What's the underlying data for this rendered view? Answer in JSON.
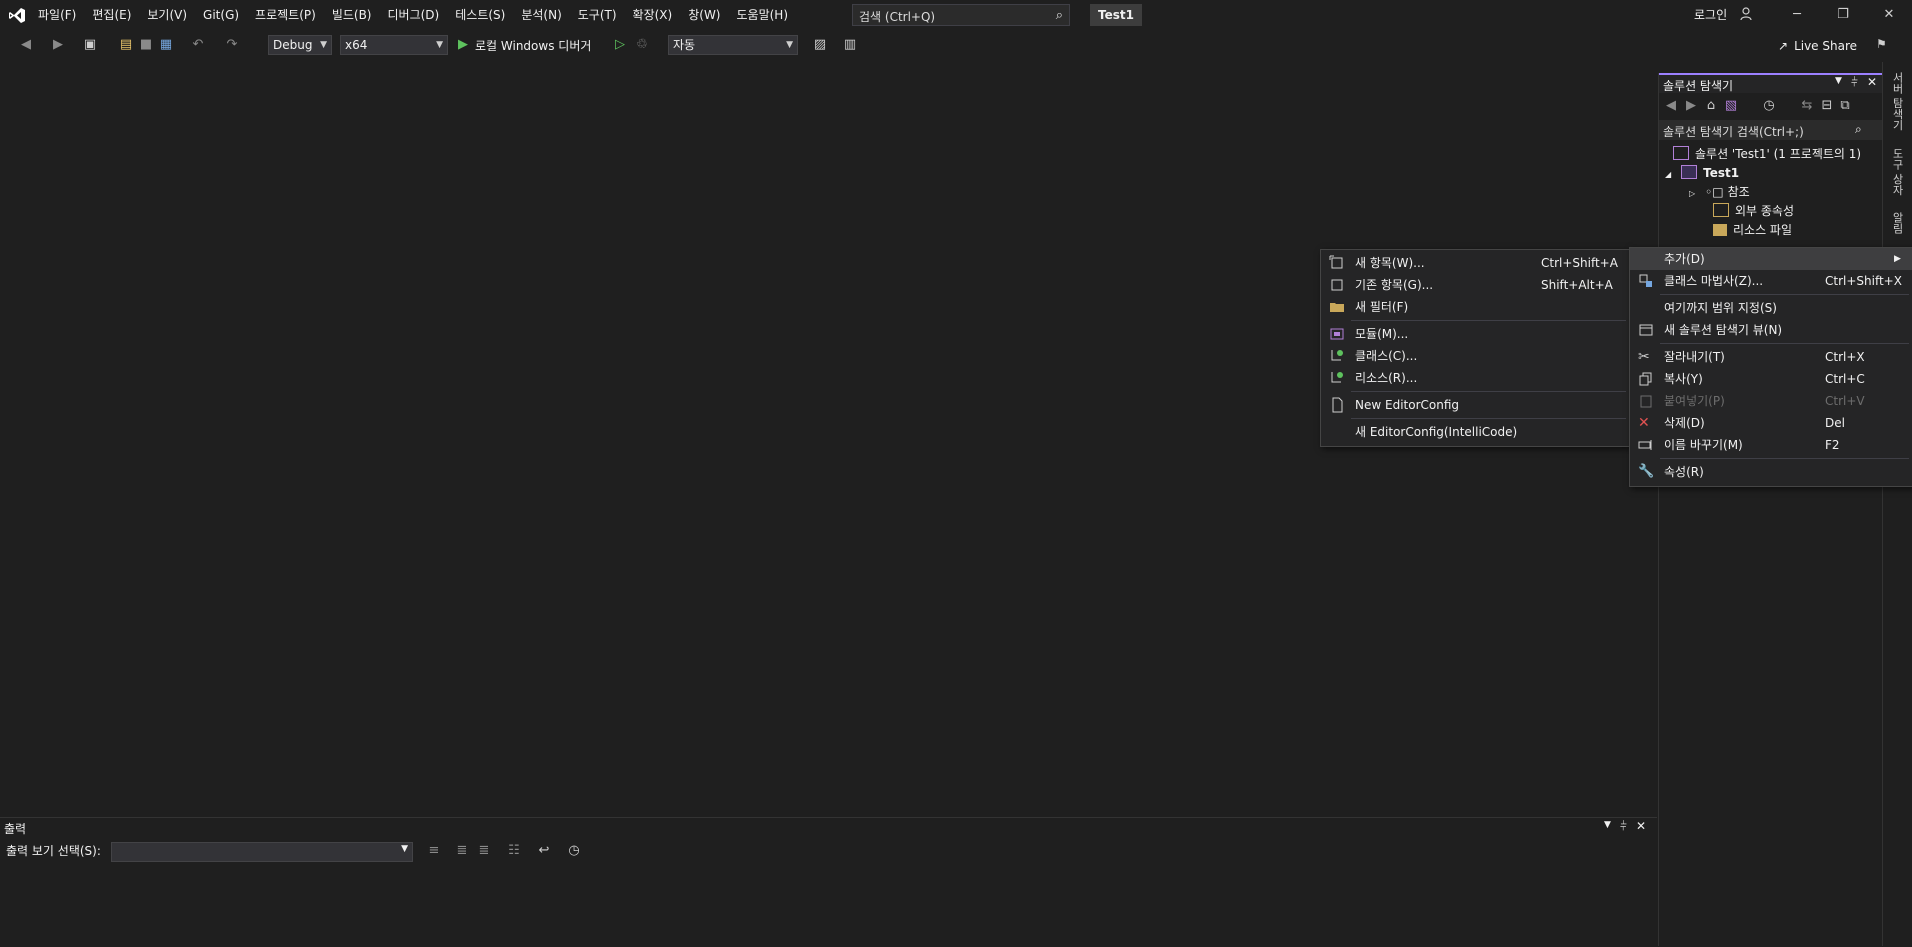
{
  "titlebar": {
    "menu": [
      "파일(F)",
      "편집(E)",
      "보기(V)",
      "Git(G)",
      "프로젝트(P)",
      "빌드(B)",
      "디버그(D)",
      "테스트(S)",
      "분석(N)",
      "도구(T)",
      "확장(X)",
      "창(W)",
      "도움말(H)"
    ],
    "search_placeholder": "검색 (Ctrl+Q)",
    "solution_name": "Test1",
    "login": "로그인",
    "window_buttons": [
      "minimize",
      "restore",
      "close"
    ]
  },
  "toolbar": {
    "config": "Debug",
    "platform": "x64",
    "run_label": "로컬 Windows 디버거",
    "target": "자동",
    "live_share": "Live Share"
  },
  "solution_explorer": {
    "title": "솔루션 탐색기",
    "search_placeholder": "솔루션 탐색기 검색(Ctrl+;)",
    "tree": [
      {
        "label": "솔루션 'Test1' (1 프로젝트의 1)",
        "bold": false
      },
      {
        "label": "Test1",
        "bold": true
      },
      {
        "label": "참조",
        "bold": false
      },
      {
        "label": "외부 종속성",
        "bold": false
      },
      {
        "label": "리소스 파일",
        "bold": false
      }
    ]
  },
  "side_tabs": [
    "서버 탐색기",
    "도구 상자",
    "알림"
  ],
  "output": {
    "title": "출력",
    "select_label": "출력 보기 선택(S):"
  },
  "context_menu": {
    "items": [
      {
        "label": "추가(D)",
        "shortcut": "",
        "highlighted": true,
        "submenu": true,
        "icon": "none"
      },
      {
        "label": "클래스 마법사(Z)...",
        "shortcut": "Ctrl+Shift+X",
        "icon": "class-wizard-icon"
      },
      {
        "label": "여기까지 범위 지정(S)",
        "shortcut": "",
        "icon": "none"
      },
      {
        "label": "새 솔루션 탐색기 뷰(N)",
        "shortcut": "",
        "icon": "new-view-icon"
      },
      {
        "label": "잘라내기(T)",
        "shortcut": "Ctrl+X",
        "icon": "cut-icon"
      },
      {
        "label": "복사(Y)",
        "shortcut": "Ctrl+C",
        "icon": "copy-icon"
      },
      {
        "label": "붙여넣기(P)",
        "shortcut": "Ctrl+V",
        "disabled": true,
        "icon": "paste-icon"
      },
      {
        "label": "삭제(D)",
        "shortcut": "Del",
        "icon": "delete-icon"
      },
      {
        "label": "이름 바꾸기(M)",
        "shortcut": "F2",
        "icon": "rename-icon"
      },
      {
        "label": "속성(R)",
        "shortcut": "",
        "icon": "wrench-icon"
      }
    ]
  },
  "submenu": {
    "items": [
      {
        "label": "새 항목(W)...",
        "shortcut": "Ctrl+Shift+A",
        "icon": "new-item-icon"
      },
      {
        "label": "기존 항목(G)...",
        "shortcut": "Shift+Alt+A",
        "icon": "existing-item-icon"
      },
      {
        "label": "새 필터(F)",
        "shortcut": "",
        "icon": "folder-icon"
      },
      {
        "label": "모듈(M)...",
        "shortcut": "",
        "icon": "module-icon"
      },
      {
        "label": "클래스(C)...",
        "shortcut": "",
        "icon": "class-icon"
      },
      {
        "label": "리소스(R)...",
        "shortcut": "",
        "icon": "resource-icon"
      },
      {
        "label": "New EditorConfig",
        "shortcut": "",
        "icon": "file-icon"
      },
      {
        "label": "새 EditorConfig(IntelliCode)",
        "shortcut": "",
        "icon": "none"
      }
    ]
  },
  "colors": {
    "accent": "#9c80ff",
    "background": "#1f1f1f",
    "menu_bg": "#252526"
  }
}
